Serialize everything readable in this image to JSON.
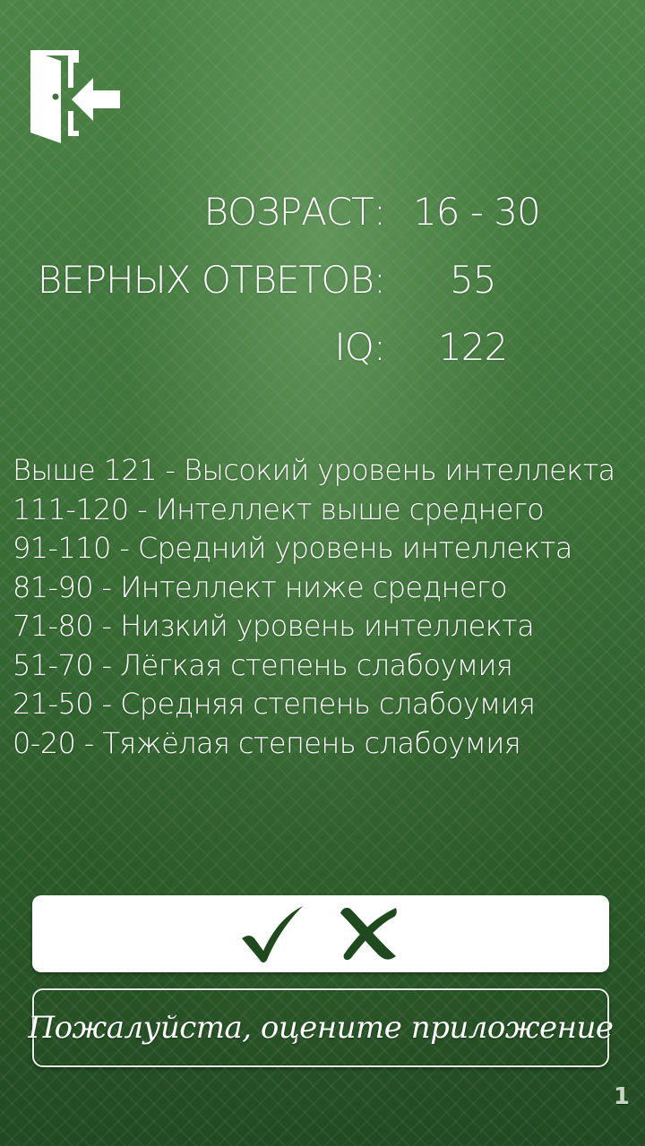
{
  "exit": {
    "icon": "exit-door-icon"
  },
  "stats": {
    "age_label": "ВОЗРАСТ:",
    "age_value": "16 - 30",
    "correct_label": "ВЕРНЫХ ОТВЕТОВ:",
    "correct_value": "55",
    "iq_label": "IQ:",
    "iq_value": "122"
  },
  "scale": [
    "Выше 121 - Высокий уровень интеллекта",
    "111-120 - Интеллект выше среднего",
    "91-110 - Средний уровень интеллекта",
    "81-90 - Интеллект ниже среднего",
    "71-80 - Низкий уровень интеллекта",
    "51-70 - Лёгкая степень слабоумия",
    "21-50 - Средняя степень слабоумия",
    "0-20 - Тяжёлая степень слабоумия"
  ],
  "answer_bar": {
    "correct_icon": "checkmark-icon",
    "wrong_icon": "cross-icon"
  },
  "rate_button": {
    "label": "Пожалуйста, оцените приложение"
  },
  "page_number": "1",
  "colors": {
    "background": "#3d7239",
    "mark": "#1f4a1d",
    "text": "#ffffff"
  }
}
